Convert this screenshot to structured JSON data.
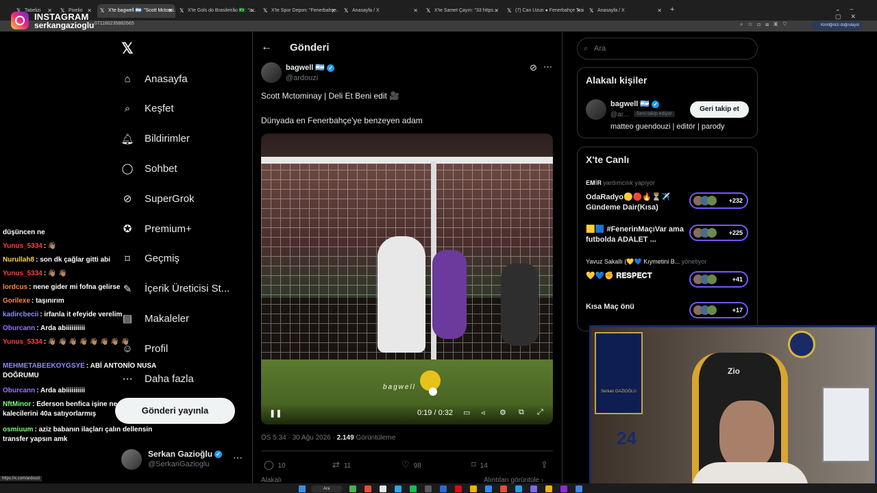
{
  "browser": {
    "tabs": [
      {
        "label": "Tabelizi",
        "active": false
      },
      {
        "label": "Pixelio",
        "active": false
      },
      {
        "label": "X'te bagwell 🇦🇷: \"Scott Mctomi...",
        "active": true
      },
      {
        "label": "X'te Gols do Brasileirão 🇧🇷: \"a...",
        "active": false
      },
      {
        "label": "X'te Spor Depon: \"Fenerbahçe...",
        "active": false
      },
      {
        "label": "Anasayfa / X",
        "active": false
      },
      {
        "label": "X'te Samet Çayırı: \"33 https...",
        "active": false
      },
      {
        "label": "(7) Can Uzun ● Fenerbahçe Trai...",
        "active": false
      },
      {
        "label": "Anasayfa / X",
        "active": false
      }
    ],
    "url": "...071180235882665",
    "verify_label": "Kimliğinizi doğrulayın",
    "status_url": "https://x.com/ardouzi"
  },
  "overlay": {
    "platform": "INSTAGRAM",
    "username": "serkangazioglu"
  },
  "sidebar": {
    "items": [
      {
        "label": "Anasayfa",
        "icon": "home-icon"
      },
      {
        "label": "Keşfet",
        "icon": "search-icon"
      },
      {
        "label": "Bildirimler",
        "icon": "bell-icon"
      },
      {
        "label": "Sohbet",
        "icon": "chat-icon"
      },
      {
        "label": "SuperGrok",
        "icon": "grok-icon"
      },
      {
        "label": "Premium+",
        "icon": "premium-icon"
      },
      {
        "label": "Geçmiş",
        "icon": "bookmark-icon"
      },
      {
        "label": "İçerik Üreticisi St...",
        "icon": "studio-icon"
      },
      {
        "label": "Makaleler",
        "icon": "article-icon"
      },
      {
        "label": "Profil",
        "icon": "profile-icon"
      },
      {
        "label": "Daha fazla",
        "icon": "more-icon"
      }
    ],
    "post_button": "Gönderi yayınla",
    "me": {
      "name": "Serkan Gazioğlu",
      "handle": "@SerkanGazioglu"
    }
  },
  "chat": [
    {
      "name": "",
      "color": "#ffffff",
      "text": "düşüncen ne"
    },
    {
      "name": "Yunus_5334",
      "color": "#ff4040",
      "text": "👋🏽"
    },
    {
      "name": "Nurullah8",
      "color": "#ffd23f",
      "text": "son dk çağlar gitti abi"
    },
    {
      "name": "Yunus_5334",
      "color": "#ff4040",
      "text": "👋🏽 👋🏽"
    },
    {
      "name": "lordcus",
      "color": "#ff8a3d",
      "text": "nene gider mi fofna gelirse"
    },
    {
      "name": "Gorilexe",
      "color": "#ff8a3d",
      "text": "taşınırım"
    },
    {
      "name": "kadircbecii",
      "color": "#8a8aff",
      "text": "irfanla it efeyide verelim"
    },
    {
      "name": "Oburcann",
      "color": "#a070ff",
      "text": "Arda abiiiiiiiiii"
    },
    {
      "name": "Yunus_5334",
      "color": "#ff4040",
      "text": "👋🏽 👋🏽 👋🏽 👋🏽 👋🏽 👋🏽 👋🏽 👋🏽"
    },
    {
      "name": "MEHMETABEEKOYGSYE",
      "color": "#8a8aff",
      "text": "ABİ ANTONİO NUSA DOĞRUMU"
    },
    {
      "name": "Oburcann",
      "color": "#a070ff",
      "text": "Arda abiiiiiiiiii"
    },
    {
      "name": "NftMinor",
      "color": "#7dff7d",
      "text": "Ederson benfica işine ne diyosun kalecilerini 40a satıyorlarmış"
    },
    {
      "name": "osmiuum",
      "color": "#7dff7d",
      "text": "aziz babanın ilaçları çalın dellensin transfer yapsın amk"
    }
  ],
  "tweet": {
    "header_title": "Gönderi",
    "author_name": "bagwell 🇦🇷",
    "author_handle": "@ardouzi",
    "line1": "Scott Mctominay  |  Deli Et Beni edit 🎥",
    "line2": "Dünyada en Fenerbahçe'ye benzeyen adam",
    "video_time": "0:19 / 0:32",
    "video_progress": 0.59,
    "video_watermark": "bagwell",
    "timestamp": "ÖS 5:34 · 30 Ağu 2026 · ",
    "views_count": "2.149",
    "views_label": " Görüntüleme",
    "replies": "10",
    "reposts": "11",
    "likes": "98",
    "bookmarks": "14",
    "related_left": "Alakalı",
    "related_right": "Alıntıları görüntüle ›"
  },
  "right": {
    "search_placeholder": "Ara",
    "related_title": "Alakalı kişiler",
    "related_person": {
      "name": "bagwell 🇦🇷",
      "handle": "@ar...",
      "badge": "Seni takip ediyor",
      "bio": "matteo guendouzi | editör | parody",
      "follow_label": "Geri takip et"
    },
    "live_title": "X'te Canlı",
    "live": [
      {
        "host": "𝐄𝐌İ𝐑",
        "status": " yardımcılık yapıyor",
        "title": "OdaRadyo🟡🔴🔥⏳✈️ Gündeme Dair(Kısa)",
        "count": "+232"
      },
      {
        "host": "",
        "status": "",
        "title": "🟨🟦 #FenerinMaçıVar ama futbolda ADALET ...",
        "count": "+225"
      },
      {
        "host": "Yavuz Sakallı (💛💙 Kıymetini B...",
        "status": " yönetiyor",
        "title": "💛💙✊ 𝐑𝐄𝐒𝐏𝐄𝐂𝐓",
        "count": "+41"
      },
      {
        "host": "",
        "status": "",
        "title": "Kısa Maç önü",
        "count": "+17"
      }
    ]
  },
  "webcam": {
    "chair_brand": "Zio",
    "jersey_name": "Serkan GAZİOĞLU",
    "jersey_number": "24"
  },
  "taskbar": {
    "search_label": "Ara"
  }
}
